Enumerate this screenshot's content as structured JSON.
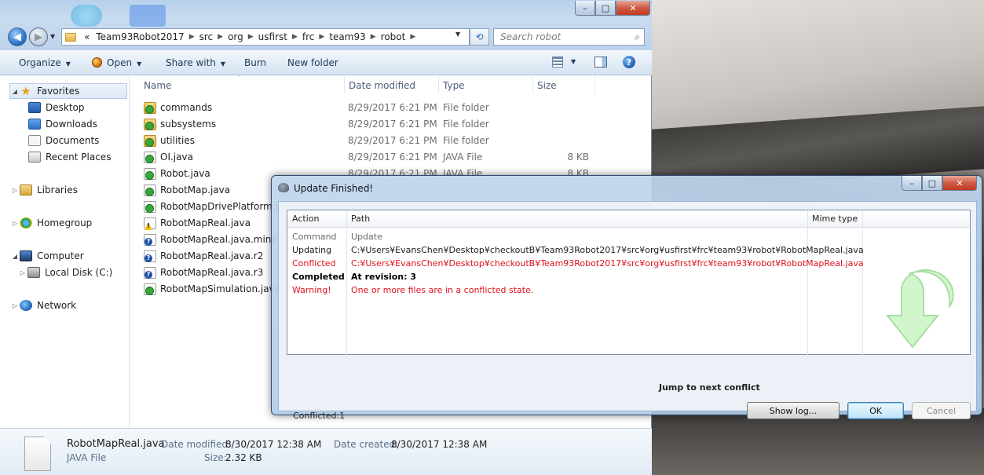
{
  "explorer": {
    "window_buttons": {
      "minimize": "–",
      "maximize": "□",
      "close": "✕"
    },
    "address": {
      "prefix": "«",
      "crumbs": [
        "Team93Robot2017",
        "src",
        "org",
        "usfirst",
        "frc",
        "team93",
        "robot"
      ]
    },
    "search_placeholder": "Search robot",
    "toolbar": {
      "organize": "Organize",
      "open": "Open",
      "share_with": "Share with",
      "burn": "Burn",
      "new_folder": "New folder",
      "help": "?"
    },
    "nav": {
      "favorites": "Favorites",
      "desktop": "Desktop",
      "downloads": "Downloads",
      "documents": "Documents",
      "recent_places": "Recent Places",
      "libraries": "Libraries",
      "homegroup": "Homegroup",
      "computer": "Computer",
      "local_disk": "Local Disk (C:)",
      "network": "Network"
    },
    "columns": {
      "name": "Name",
      "date": "Date modified",
      "type": "Type",
      "size": "Size"
    },
    "files": [
      {
        "name": "commands",
        "date": "8/29/2017 6:21 PM",
        "type": "File folder",
        "size": "",
        "icon": "folder-ok"
      },
      {
        "name": "subsystems",
        "date": "8/29/2017 6:21 PM",
        "type": "File folder",
        "size": "",
        "icon": "folder-ok"
      },
      {
        "name": "utilities",
        "date": "8/29/2017 6:21 PM",
        "type": "File folder",
        "size": "",
        "icon": "folder-ok"
      },
      {
        "name": "OI.java",
        "date": "8/29/2017 6:21 PM",
        "type": "JAVA File",
        "size": "8 KB",
        "icon": "java-ok"
      },
      {
        "name": "Robot.java",
        "date": "8/29/2017 6:21 PM",
        "type": "JAVA File",
        "size": "8 KB",
        "icon": "java-ok"
      },
      {
        "name": "RobotMap.java",
        "date": "",
        "type": "",
        "size": "",
        "icon": "java-ok"
      },
      {
        "name": "RobotMapDrivePlatform.java",
        "date": "",
        "type": "",
        "size": "",
        "icon": "java-ok"
      },
      {
        "name": "RobotMapReal.java",
        "date": "",
        "type": "",
        "size": "",
        "icon": "java-warn"
      },
      {
        "name": "RobotMapReal.java.mine",
        "date": "",
        "type": "",
        "size": "",
        "icon": "unknown"
      },
      {
        "name": "RobotMapReal.java.r2",
        "date": "",
        "type": "",
        "size": "",
        "icon": "unknown"
      },
      {
        "name": "RobotMapReal.java.r3",
        "date": "",
        "type": "",
        "size": "",
        "icon": "unknown"
      },
      {
        "name": "RobotMapSimulation.java",
        "date": "",
        "type": "",
        "size": "",
        "icon": "java-ok"
      }
    ],
    "details": {
      "name": "RobotMapReal.java",
      "type": "JAVA File",
      "date_modified_label": "Date modified:",
      "date_modified": "8/30/2017 12:38 AM",
      "date_created_label": "Date created:",
      "date_created": "8/30/2017 12:38 AM",
      "size_label": "Size:",
      "size": "2.32 KB"
    }
  },
  "dialog": {
    "title": "Update Finished!",
    "columns": {
      "action": "Action",
      "path": "Path",
      "mime": "Mime type"
    },
    "rows": [
      {
        "action": "Command",
        "path": "Update",
        "style": "gray"
      },
      {
        "action": "Updating",
        "path": "C:¥Users¥EvansChen¥Desktop¥checkoutB¥Team93Robot2017¥src¥org¥usfirst¥frc¥team93¥robot¥RobotMapReal.java",
        "style": "normal"
      },
      {
        "action": "Conflicted",
        "path": "C:¥Users¥EvansChen¥Desktop¥checkoutB¥Team93Robot2017¥src¥org¥usfirst¥frc¥team93¥robot¥RobotMapReal.java",
        "style": "red"
      },
      {
        "action": "Completed",
        "path": "At revision: 3",
        "style": "bold"
      },
      {
        "action": "Warning!",
        "path": "One or more files are in a conflicted state.",
        "style": "red"
      }
    ],
    "jump_link": "Jump to next conflict",
    "conflicted_count": "Conflicted:1",
    "buttons": {
      "show_log": "Show log...",
      "ok": "OK",
      "cancel": "Cancel"
    }
  },
  "colors": {
    "conflict_red": "#e0101c",
    "accent_blue": "#3c7fb1"
  }
}
